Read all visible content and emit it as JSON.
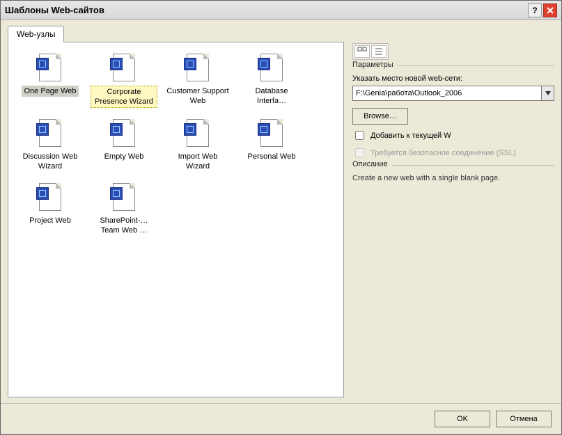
{
  "window": {
    "title": "Шаблоны Web-сайтов"
  },
  "tab": {
    "label": "Web-узлы"
  },
  "templates": [
    {
      "label": "One Page Web",
      "state": "selected"
    },
    {
      "label": "Corporate Presence Wizard",
      "state": "highlight"
    },
    {
      "label": "Customer Support Web",
      "state": ""
    },
    {
      "label": "Database Interfa…",
      "state": ""
    },
    {
      "label": "Discussion Web Wizard",
      "state": ""
    },
    {
      "label": "Empty Web",
      "state": ""
    },
    {
      "label": "Import Web Wizard",
      "state": ""
    },
    {
      "label": "Personal Web",
      "state": ""
    },
    {
      "label": "Project Web",
      "state": ""
    },
    {
      "label": "SharePoint-… Team Web …",
      "state": ""
    }
  ],
  "params": {
    "group_title": "Параметры",
    "location_label": "Указать место новой web-сети:",
    "location_value": "F:\\Genia\\работа\\Outlook_2006",
    "browse": "Browse…",
    "checkbox_add": "Добавить к текущей W",
    "checkbox_secure": "Требуется безопасное соединение (SSL)"
  },
  "description": {
    "group_title": "Описание",
    "text": "Create a new web with a single blank page."
  },
  "buttons": {
    "ok": "OK",
    "cancel": "Отмена"
  }
}
